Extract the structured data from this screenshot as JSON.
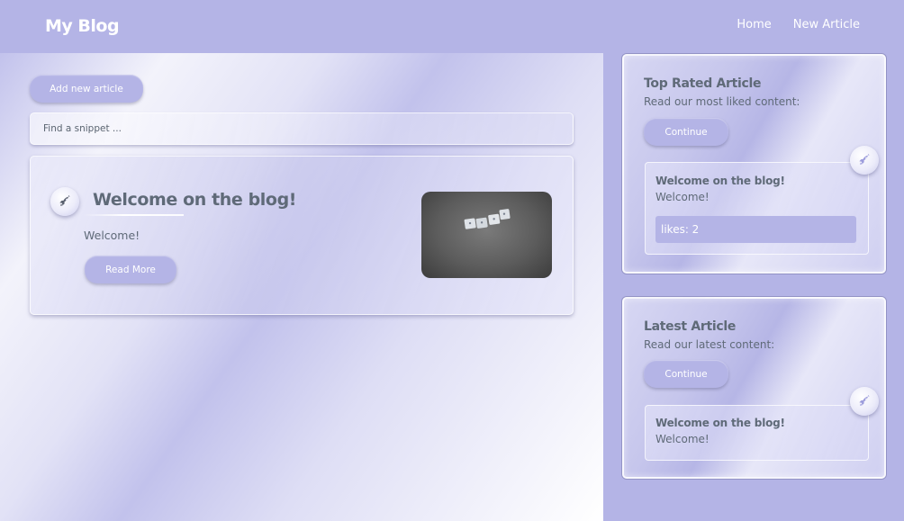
{
  "header": {
    "brand": "My Blog",
    "nav": [
      {
        "label": "Home"
      },
      {
        "label": "New Article"
      }
    ]
  },
  "main": {
    "add_button": "Add new article",
    "search": {
      "placeholder": "Find a snippet ..."
    },
    "posts": [
      {
        "title": "Welcome on the blog!",
        "excerpt": "Welcome!",
        "read_more": "Read More",
        "image_icon": "scrabble-tiles-image"
      }
    ]
  },
  "sidebar": {
    "top_rated": {
      "title": "Top Rated Article",
      "subtitle": "Read our most liked content:",
      "button": "Continue",
      "article_title": "Welcome on the blog!",
      "article_text": "Welcome!",
      "likes": "likes: 2"
    },
    "latest": {
      "title": "Latest Article",
      "subtitle": "Read our latest content:",
      "button": "Continue",
      "article_title": "Welcome on the blog!",
      "article_text": "Welcome!"
    }
  },
  "colors": {
    "accent": "#b4b4e6",
    "text": "#5f6a78",
    "white": "#ffffff"
  }
}
